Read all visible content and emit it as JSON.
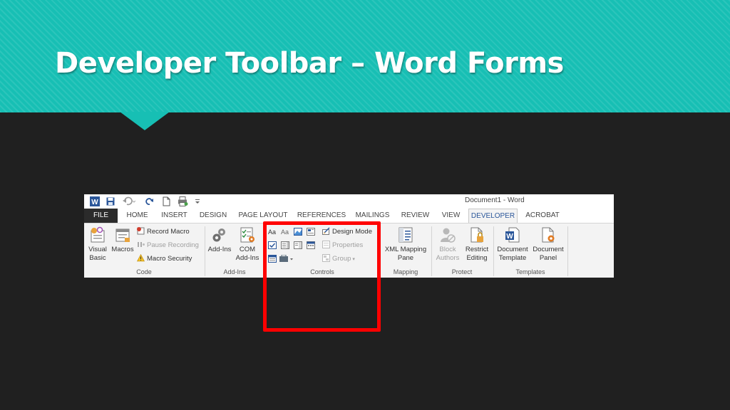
{
  "slide": {
    "title": "Developer Toolbar – Word Forms"
  },
  "word": {
    "window_title": "Document1 - Word",
    "qat_icons": [
      "word-logo-icon",
      "save-icon",
      "undo-icon",
      "redo-icon",
      "new-document-icon",
      "print-preview-icon",
      "customize-qat-icon"
    ],
    "tabs": [
      "FILE",
      "HOME",
      "INSERT",
      "DESIGN",
      "PAGE LAYOUT",
      "REFERENCES",
      "MAILINGS",
      "REVIEW",
      "VIEW",
      "DEVELOPER",
      "ACROBAT"
    ],
    "active_tab": "DEVELOPER",
    "groups": {
      "code": {
        "label": "Code",
        "visual_basic": "Visual Basic",
        "macros": "Macros",
        "record_macro": "Record Macro",
        "pause_recording": "Pause Recording",
        "macro_security": "Macro Security"
      },
      "addins": {
        "label": "Add-Ins",
        "addins": "Add-Ins",
        "com_addins": "COM Add-Ins"
      },
      "controls": {
        "label": "Controls",
        "design_mode": "Design Mode",
        "properties": "Properties",
        "group": "Group",
        "control_icons": [
          "rich-text-control-icon",
          "plain-text-control-icon",
          "picture-control-icon",
          "building-block-control-icon",
          "checkbox-control-icon",
          "combo-box-control-icon",
          "dropdown-control-icon",
          "date-picker-control-icon",
          "repeating-section-control-icon",
          "legacy-tools-icon"
        ]
      },
      "mapping": {
        "label": "Mapping",
        "xml_mapping_pane": "XML Mapping Pane"
      },
      "protect": {
        "label": "Protect",
        "block_authors": "Block Authors",
        "restrict_editing": "Restrict Editing"
      },
      "templates": {
        "label": "Templates",
        "document_template": "Document Template",
        "document_panel": "Document Panel"
      }
    }
  },
  "colors": {
    "header_teal": "#17bfb4",
    "background": "#202020",
    "highlight": "#ff0000",
    "word_blue": "#2b579a"
  }
}
